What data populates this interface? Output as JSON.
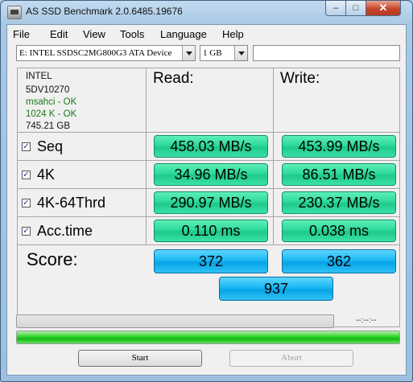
{
  "window": {
    "title": "AS SSD Benchmark 2.0.6485.19676",
    "minimize": "–",
    "maximize": "□",
    "close": "✕"
  },
  "menu": [
    "File",
    "Edit",
    "View",
    "Tools",
    "Language",
    "Help"
  ],
  "drive_select": {
    "value": "E: INTEL SSDSC2MG800G3 ATA Device"
  },
  "size_select": {
    "value": "1 GB"
  },
  "drive_info": {
    "vendor": "INTEL",
    "firmware": "5DV10270",
    "driver": "msahci - OK",
    "alignment": "1024 K - OK",
    "capacity": "745.21 GB"
  },
  "headers": {
    "read": "Read:",
    "write": "Write:"
  },
  "tests": [
    {
      "label": "Seq",
      "checked": true,
      "read": "458.03 MB/s",
      "write": "453.99 MB/s"
    },
    {
      "label": "4K",
      "checked": true,
      "read": "34.96 MB/s",
      "write": "86.51 MB/s"
    },
    {
      "label": "4K-64Thrd",
      "checked": true,
      "read": "290.97 MB/s",
      "write": "230.37 MB/s"
    },
    {
      "label": "Acc.time",
      "checked": true,
      "read": "0.110 ms",
      "write": "0.038 ms"
    }
  ],
  "score": {
    "label": "Score:",
    "read": "372",
    "write": "362",
    "total": "937"
  },
  "progress": {
    "test_fraction": 0.0,
    "total_fraction": 1.0,
    "time": "--:--:--"
  },
  "buttons": {
    "start": "Start",
    "abort": "Abort"
  },
  "colors": {
    "result_green": "#2ed99a",
    "score_blue": "#1ab7f2",
    "progress_green": "#2fd32a"
  }
}
